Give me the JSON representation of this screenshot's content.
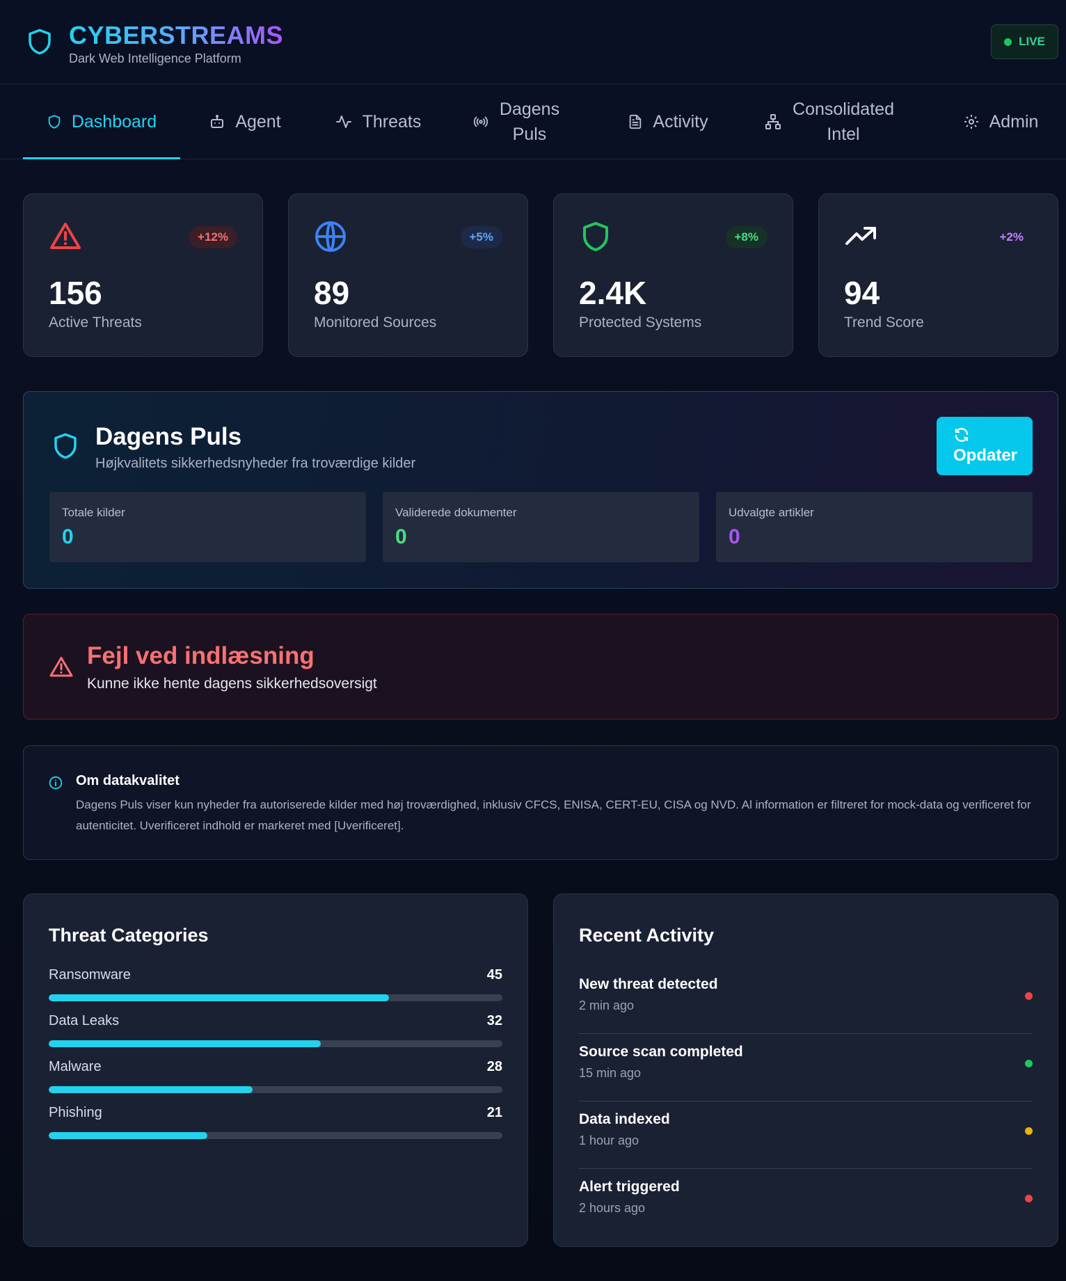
{
  "header": {
    "brand": "CYBERSTREAMS",
    "subtitle": "Dark Web Intelligence Platform",
    "live_label": "LIVE"
  },
  "nav": {
    "items": [
      {
        "label": "Dashboard",
        "icon": "shield-icon",
        "active": true
      },
      {
        "label": "Agent",
        "icon": "bot-icon"
      },
      {
        "label": "Threats",
        "icon": "activity-icon"
      },
      {
        "label": "Dagens Puls",
        "icon": "radio-icon"
      },
      {
        "label": "Activity",
        "icon": "file-text-icon"
      },
      {
        "label": "Consolidated Intel",
        "icon": "network-icon"
      },
      {
        "label": "Admin",
        "icon": "gear-icon"
      }
    ]
  },
  "stats": [
    {
      "value": "156",
      "label": "Active Threats",
      "change": "+12%",
      "icon": "alert-triangle-icon",
      "color": "#ef4444"
    },
    {
      "value": "89",
      "label": "Monitored Sources",
      "change": "+5%",
      "icon": "globe-icon",
      "color": "#3b82f6"
    },
    {
      "value": "2.4K",
      "label": "Protected Systems",
      "change": "+8%",
      "icon": "shield-icon",
      "color": "#22c55e"
    },
    {
      "value": "94",
      "label": "Trend Score",
      "change": "+2%",
      "icon": "trending-up-icon",
      "color": "#a855f7"
    }
  ],
  "pulse": {
    "title": "Dagens Puls",
    "subtitle": "Højkvalitets sikkerhedsnyheder fra troværdige kilder",
    "refresh_label": "Opdater",
    "stats": [
      {
        "label": "Totale kilder",
        "value": "0",
        "color": "#22d3ee"
      },
      {
        "label": "Validerede dokumenter",
        "value": "0",
        "color": "#4ade80"
      },
      {
        "label": "Udvalgte artikler",
        "value": "0",
        "color": "#a855f7"
      }
    ]
  },
  "error": {
    "title": "Fejl ved indlæsning",
    "message": "Kunne ikke hente dagens sikkerhedsoversigt"
  },
  "info": {
    "title": "Om datakvalitet",
    "body": "Dagens Puls viser kun nyheder fra autoriserede kilder med høj troværdighed, inklusiv CFCS, ENISA, CERT-EU, CISA og NVD. Al information er filtreret for mock-data og verificeret for autenticitet. Uverificeret indhold er markeret med [Uverificeret]."
  },
  "threat_categories": {
    "title": "Threat Categories",
    "items": [
      {
        "name": "Ransomware",
        "count": "45",
        "fraction": 0.75
      },
      {
        "name": "Data Leaks",
        "count": "32",
        "fraction": 0.6
      },
      {
        "name": "Malware",
        "count": "28",
        "fraction": 0.45
      },
      {
        "name": "Phishing",
        "count": "21",
        "fraction": 0.35
      }
    ]
  },
  "recent_activity": {
    "title": "Recent Activity",
    "items": [
      {
        "title": "New threat detected",
        "time": "2 min ago",
        "status_color": "#ef4444"
      },
      {
        "title": "Source scan completed",
        "time": "15 min ago",
        "status_color": "#22c55e"
      },
      {
        "title": "Data indexed",
        "time": "1 hour ago",
        "status_color": "#eab308"
      },
      {
        "title": "Alert triggered",
        "time": "2 hours ago",
        "status_color": "#ef4444"
      }
    ]
  }
}
